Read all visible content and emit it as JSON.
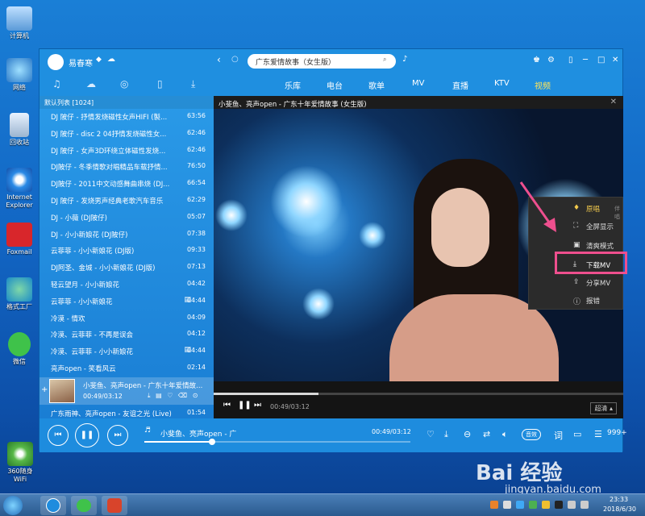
{
  "desktop": {
    "icons": [
      {
        "label": "计算机",
        "icon": "computer-icon"
      },
      {
        "label": "网络",
        "icon": "network-icon"
      },
      {
        "label": "回收站",
        "icon": "recycle-bin-icon"
      },
      {
        "label": "Internet\nExplorer",
        "icon": "ie-icon"
      },
      {
        "label": "Foxmail",
        "icon": "foxmail-icon"
      },
      {
        "label": "格式工厂",
        "icon": "format-factory-icon"
      },
      {
        "label": "微信",
        "icon": "wechat-icon"
      },
      {
        "label": "360随身WiFi",
        "icon": "wifi-icon"
      }
    ]
  },
  "player": {
    "username": "易春寒",
    "search_value": "广东爱情故事（女生版）",
    "nav_tabs": [
      "乐库",
      "电台",
      "歌单",
      "MV",
      "直播",
      "KTV",
      "视频"
    ],
    "active_tab": "视频",
    "playlist": {
      "header": "默认列表 [1024]",
      "items": [
        {
          "title": "DJ 陂仔 - 抒情发烧磁性女声HIFI (製...",
          "duration": "63:56",
          "mv": false
        },
        {
          "title": "DJ 陂仔 - disc 2 04抒情发烧磁性女...",
          "duration": "62:46",
          "mv": false
        },
        {
          "title": "DJ 陂仔 - 女声3D环绕立体磁性发烧...",
          "duration": "62:46",
          "mv": false
        },
        {
          "title": "DJ陂仔 - 冬季情歌对唱精品车载抒情...",
          "duration": "76:50",
          "mv": false
        },
        {
          "title": "DJ陂仔 - 2011中文动感舞曲串烧 (DJ...",
          "duration": "66:54",
          "mv": false
        },
        {
          "title": "DJ 陂仔 - 发烧男声经典老歌汽车音乐",
          "duration": "62:29",
          "mv": false
        },
        {
          "title": "DJ - 小薇 (DJ陂仔)",
          "duration": "05:07",
          "mv": false
        },
        {
          "title": "DJ - 小小新娘花 (DJ陂仔)",
          "duration": "07:38",
          "mv": false
        },
        {
          "title": "云菲菲 - 小小新娘花 (DJ版)",
          "duration": "09:33",
          "mv": false
        },
        {
          "title": "DJ阿圣、金城 - 小小新娘花 (DJ版)",
          "duration": "07:13",
          "mv": false
        },
        {
          "title": "轻云望月 - 小小新娘花",
          "duration": "04:42",
          "mv": false
        },
        {
          "title": "云菲菲 - 小小新娘花",
          "duration": "04:44",
          "mv": true
        },
        {
          "title": "冷漠 - 情欢",
          "duration": "04:09",
          "mv": false
        },
        {
          "title": "冷漠、云菲菲 - 不再是误会",
          "duration": "04:12",
          "mv": false
        },
        {
          "title": "冷漠、云菲菲 - 小小新娘花",
          "duration": "04:44",
          "mv": true
        },
        {
          "title": "亮声open - 笑看风云",
          "duration": "02:14",
          "mv": false
        }
      ],
      "now_playing": {
        "title": "小斐鱼、亮声open - 广东十年爱情故...",
        "time": "00:49/03:12"
      },
      "last_item": {
        "title": "广东雨神、亮声open - 友谊之光 (Live)",
        "duration": "01:54"
      }
    },
    "video": {
      "title": "小斐鱼、亮声open - 广东十年爱情故事 (女生版)",
      "time": "00:49/03:12",
      "progress": 0.255,
      "quality": "超清 ▴"
    },
    "context_menu": {
      "items": [
        {
          "icon": "microphone-icon",
          "label": "原唱",
          "hint": "伴唱"
        },
        {
          "icon": "fullscreen-icon",
          "label": "全屏显示",
          "hint": ""
        },
        {
          "icon": "clean-mode-icon",
          "label": "清爽模式",
          "hint": ""
        },
        {
          "icon": "download-icon",
          "label": "下载MV",
          "hint": ""
        },
        {
          "icon": "share-icon",
          "label": "分享MV",
          "hint": ""
        },
        {
          "icon": "report-icon",
          "label": "报错",
          "hint": ""
        }
      ]
    },
    "bottom": {
      "song": "小斐鱼、亮声open - 广",
      "time": "00:49/03:12",
      "progress": 0.255,
      "sound_effect": "音效",
      "lyrics": "词",
      "count": "999+"
    }
  },
  "watermark": {
    "logo": "Bai 经验",
    "url": "jingyan.baidu.com"
  },
  "taskbar": {
    "time": "23:33",
    "date": "2018/6/30"
  },
  "colors": {
    "accent": "#ffe45a",
    "highlight": "#ee4f8e",
    "window_blue": "#1e8cde"
  }
}
